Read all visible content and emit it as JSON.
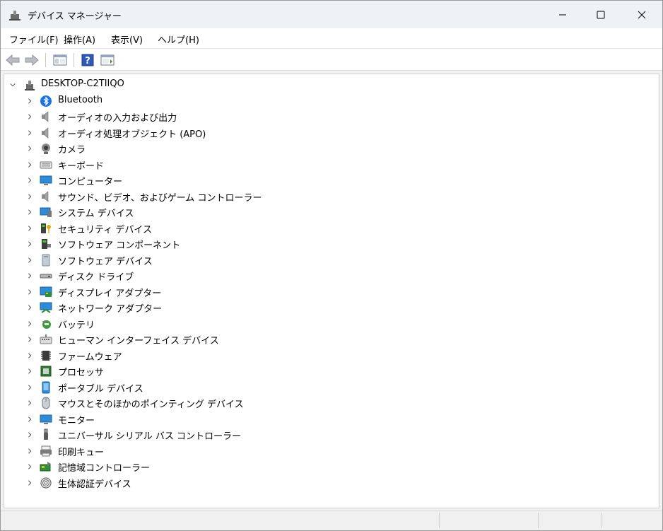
{
  "window": {
    "title": "デバイス マネージャー"
  },
  "menu": [
    {
      "label": "ファイル(F)"
    },
    {
      "label": "操作(A)"
    },
    {
      "label": "表示(V)"
    },
    {
      "label": "ヘルプ(H)"
    }
  ],
  "tree": {
    "root": {
      "label": "DESKTOP-C2TIIQO",
      "expanded": true
    },
    "categories": [
      {
        "label": "Bluetooth",
        "icon": "bluetooth-icon"
      },
      {
        "label": "オーディオの入力および出力",
        "icon": "speaker-icon"
      },
      {
        "label": "オーディオ処理オブジェクト (APO)",
        "icon": "speaker-icon"
      },
      {
        "label": "カメラ",
        "icon": "camera-icon"
      },
      {
        "label": "キーボード",
        "icon": "keyboard-icon"
      },
      {
        "label": "コンピューター",
        "icon": "computer-icon"
      },
      {
        "label": "サウンド、ビデオ、およびゲーム コントローラー",
        "icon": "speaker-icon"
      },
      {
        "label": "システム デバイス",
        "icon": "system-device-icon"
      },
      {
        "label": "セキュリティ デバイス",
        "icon": "security-key-icon"
      },
      {
        "label": "ソフトウェア コンポーネント",
        "icon": "software-component-icon"
      },
      {
        "label": "ソフトウェア デバイス",
        "icon": "software-device-icon"
      },
      {
        "label": "ディスク ドライブ",
        "icon": "disk-drive-icon"
      },
      {
        "label": "ディスプレイ アダプター",
        "icon": "display-adapter-icon"
      },
      {
        "label": "ネットワーク アダプター",
        "icon": "network-adapter-icon"
      },
      {
        "label": "バッテリ",
        "icon": "battery-icon"
      },
      {
        "label": "ヒューマン インターフェイス デバイス",
        "icon": "hid-icon"
      },
      {
        "label": "ファームウェア",
        "icon": "firmware-chip-icon"
      },
      {
        "label": "プロセッサ",
        "icon": "processor-icon"
      },
      {
        "label": "ポータブル デバイス",
        "icon": "portable-device-icon"
      },
      {
        "label": "マウスとそのほかのポインティング デバイス",
        "icon": "mouse-icon"
      },
      {
        "label": "モニター",
        "icon": "monitor-icon"
      },
      {
        "label": "ユニバーサル シリアル バス コントローラー",
        "icon": "usb-icon"
      },
      {
        "label": "印刷キュー",
        "icon": "printer-icon"
      },
      {
        "label": "記憶域コントローラー",
        "icon": "storage-controller-icon"
      },
      {
        "label": "生体認証デバイス",
        "icon": "fingerprint-icon"
      }
    ]
  },
  "colors": {
    "titlebar": "#eef2f6",
    "accent": "#0067c0"
  }
}
